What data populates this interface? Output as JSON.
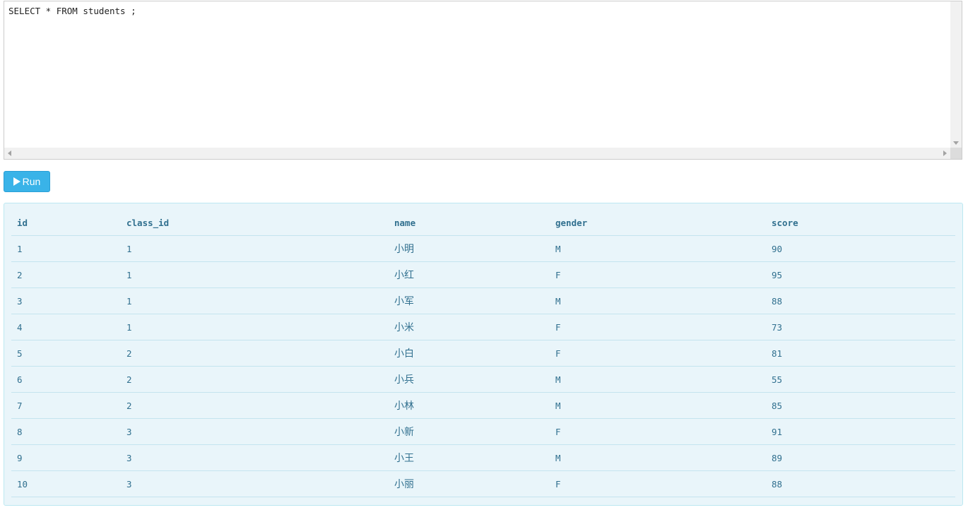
{
  "editor": {
    "query": "SELECT * FROM students ;"
  },
  "toolbar": {
    "run_label": "Run",
    "run_icon": "play-icon"
  },
  "results": {
    "columns": [
      "id",
      "class_id",
      "name",
      "gender",
      "score"
    ],
    "rows": [
      [
        "1",
        "1",
        "小明",
        "M",
        "90"
      ],
      [
        "2",
        "1",
        "小红",
        "F",
        "95"
      ],
      [
        "3",
        "1",
        "小军",
        "M",
        "88"
      ],
      [
        "4",
        "1",
        "小米",
        "F",
        "73"
      ],
      [
        "5",
        "2",
        "小白",
        "F",
        "81"
      ],
      [
        "6",
        "2",
        "小兵",
        "M",
        "55"
      ],
      [
        "7",
        "2",
        "小林",
        "M",
        "85"
      ],
      [
        "8",
        "3",
        "小新",
        "F",
        "91"
      ],
      [
        "9",
        "3",
        "小王",
        "M",
        "89"
      ],
      [
        "10",
        "3",
        "小丽",
        "F",
        "88"
      ]
    ]
  },
  "colors": {
    "run_button": "#39b3e8",
    "result_bg": "#e9f5fa",
    "result_text": "#31708f"
  }
}
